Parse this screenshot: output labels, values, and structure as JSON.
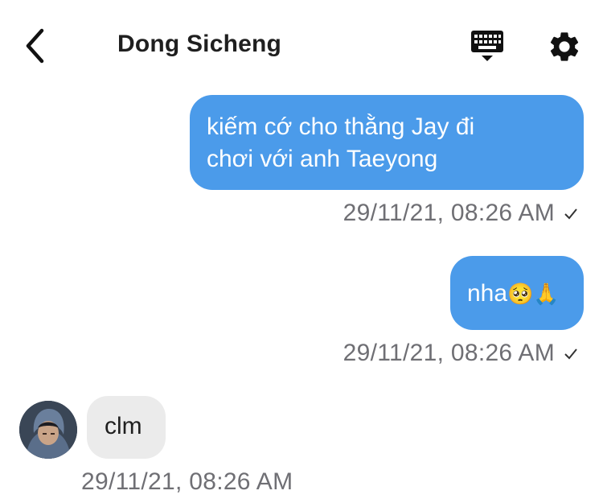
{
  "header": {
    "title": "Dong Sicheng",
    "icons": [
      "back-chevron-icon",
      "keyboard-icon",
      "gear-icon"
    ]
  },
  "messages": [
    {
      "direction": "sent",
      "text_line1": "kiếm cớ cho thằng Jay đi",
      "text_line2": "chơi với anh Taeyong",
      "timestamp": "29/11/21, 08:26 AM",
      "status": "✓"
    },
    {
      "direction": "sent",
      "text": "nha",
      "emoji": "🥺🙏",
      "timestamp": "29/11/21, 08:26 AM",
      "status": "✓"
    },
    {
      "direction": "received",
      "text": "clm",
      "timestamp": "29/11/21, 08:26 AM"
    }
  ],
  "colors": {
    "sent_bubble": "#4b9bea",
    "received_bubble": "#ebebeb",
    "timestamp": "#6f6f74"
  }
}
